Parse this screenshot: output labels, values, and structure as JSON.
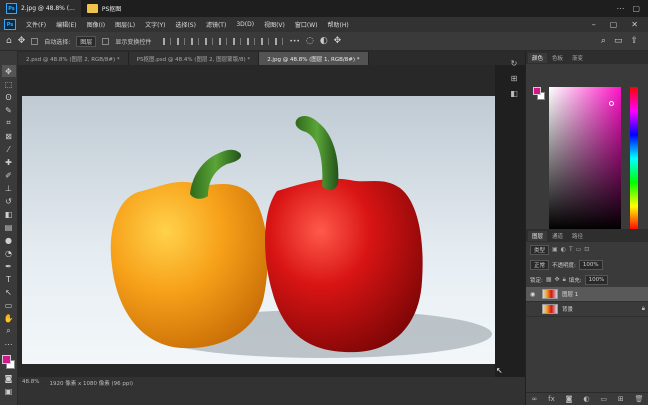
{
  "taskbar": {
    "tasks": [
      {
        "label": "2.jpg @ 48.8% (..."
      },
      {
        "label": "PS抠图"
      }
    ]
  },
  "menubar": {
    "logo": "Ps",
    "items": [
      "文件(F)",
      "编辑(E)",
      "图像(I)",
      "图层(L)",
      "文字(Y)",
      "选择(S)",
      "滤镜(T)",
      "3D(D)",
      "视图(V)",
      "窗口(W)",
      "帮助(H)"
    ]
  },
  "options": {
    "auto_select_label": "自动选择:",
    "auto_select_value": "图层",
    "show_transform_label": "显示变换控件"
  },
  "tabs": [
    {
      "label": "2.psd @ 48.8% (图层 2, RGB/8#) *"
    },
    {
      "label": "PS抠图.psd @ 48.4% (图层 2, 图层蒙版/8) *"
    },
    {
      "label": "2.jpg @ 48.8% (图层 1, RGB/8#) *"
    }
  ],
  "status": {
    "zoom": "48.8%",
    "doc_info": "1920 像素 x 1080 像素 (96 ppi)"
  },
  "color_panel": {
    "tabs": [
      "颜色",
      "色板",
      "渐变"
    ],
    "foreground": "#d4178a",
    "background": "#ffffff"
  },
  "layers_panel": {
    "tabs": [
      "图层",
      "通道",
      "路径"
    ],
    "filter_label": "类型",
    "blend_mode": "正常",
    "opacity_label": "不透明度:",
    "opacity_value": "100%",
    "lock_label": "锁定:",
    "fill_label": "填充:",
    "fill_value": "100%",
    "layers": [
      {
        "name": "图层 1"
      },
      {
        "name": "背景"
      }
    ]
  }
}
